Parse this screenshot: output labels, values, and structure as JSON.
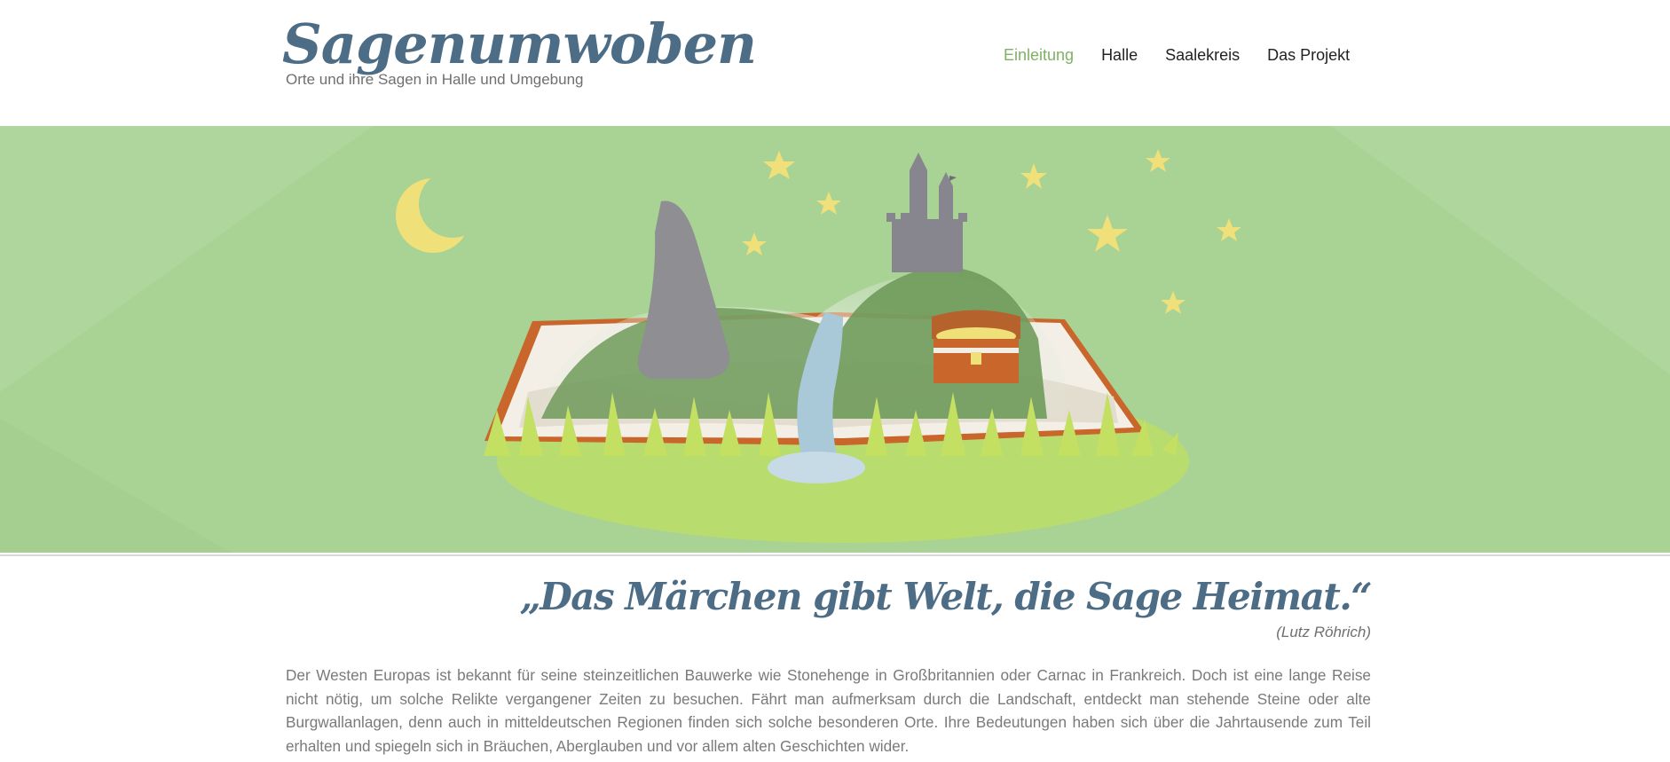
{
  "site": {
    "title": "Sagenumwoben",
    "tagline": "Orte und ihre Sagen in Halle und Umgebung"
  },
  "nav": {
    "items": [
      {
        "label": "Einleitung",
        "active": true
      },
      {
        "label": "Halle",
        "active": false
      },
      {
        "label": "Saalekreis",
        "active": false
      },
      {
        "label": "Das Projekt",
        "active": false
      }
    ]
  },
  "hero": {
    "illustration": "open book with grass, menhir, castle on hill, waterfall, treasure chest, moon and stars",
    "background_color": "#a9d295"
  },
  "quote": {
    "text": "„Das Märchen gibt Welt, die Sage Heimat.“",
    "author": "(Lutz Röhrich)"
  },
  "intro": {
    "text": "Der Westen Europas ist bekannt für seine steinzeitlichen Bauwerke wie Stonehenge in Großbritannien oder Carnac in Frankreich. Doch ist eine lange Reise nicht nötig, um solche Relikte vergangener Zeiten zu besuchen. Fährt man aufmerksam durch die Landschaft, entdeckt man stehende Steine oder alte Burgwallanlagen, denn auch in mitteldeutschen Regionen finden sich solche besonderen Orte. Ihre Bedeutungen haben sich über die Jahrtausende zum Teil erhalten und spiegeln sich in Bräuchen, Aberglauben und vor allem alten Geschichten wider."
  },
  "colors": {
    "brand": "#4d6d86",
    "nav_active": "#7fb166",
    "text": "#707070"
  }
}
